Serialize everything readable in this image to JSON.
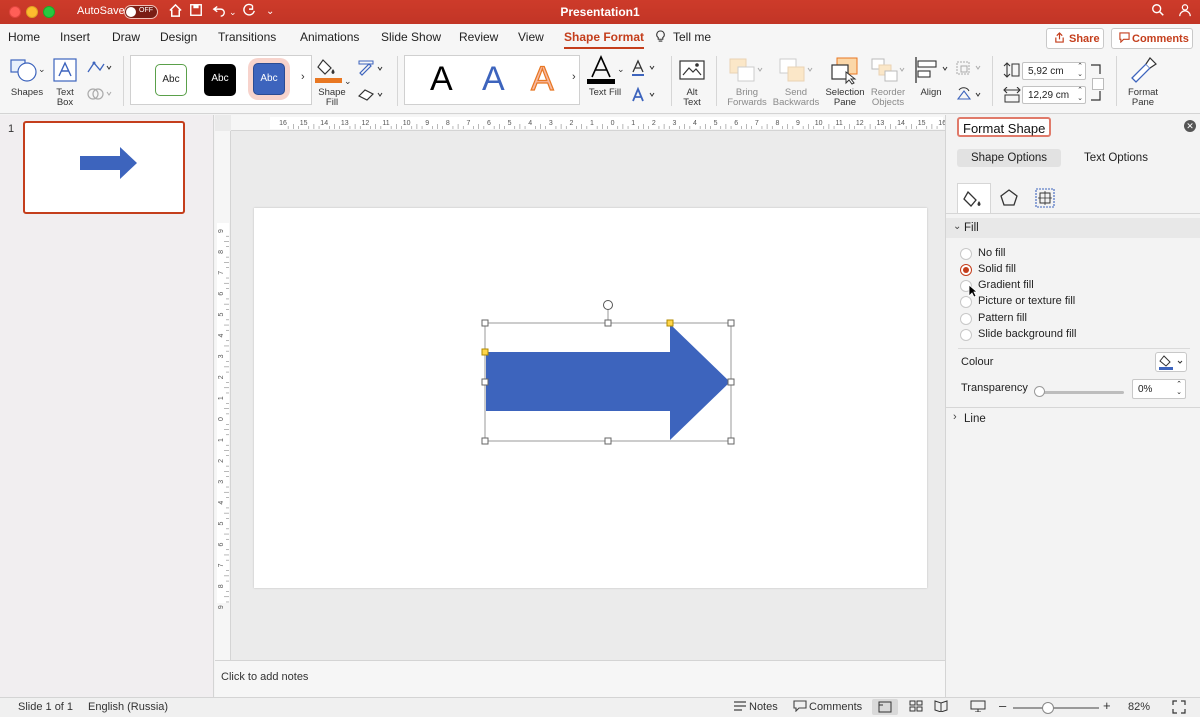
{
  "window": {
    "title": "Presentation1",
    "autosave_label": "AutoSave",
    "autosave_state": "OFF"
  },
  "tabs": [
    {
      "label": "Home"
    },
    {
      "label": "Insert"
    },
    {
      "label": "Draw"
    },
    {
      "label": "Design"
    },
    {
      "label": "Transitions"
    },
    {
      "label": "Animations"
    },
    {
      "label": "Slide Show"
    },
    {
      "label": "Review"
    },
    {
      "label": "View"
    },
    {
      "label": "Shape Format",
      "active": true
    },
    {
      "label": "Tell me"
    }
  ],
  "actions": {
    "share": "Share",
    "comments": "Comments"
  },
  "ribbon": {
    "shapes": "Shapes",
    "text_box_1": "Text",
    "text_box_2": "Box",
    "style_1": "Abc",
    "style_2": "Abc",
    "style_3": "Abc",
    "shape_fill_1": "Shape",
    "shape_fill_2": "Fill",
    "wordart": "A",
    "text_fill": "Text Fill",
    "alt_text_1": "Alt",
    "alt_text_2": "Text",
    "bring_forwards_1": "Bring",
    "bring_forwards_2": "Forwards",
    "send_backwards_1": "Send",
    "send_backwards_2": "Backwards",
    "selection_pane_1": "Selection",
    "selection_pane_2": "Pane",
    "reorder_objects_1": "Reorder",
    "reorder_objects_2": "Objects",
    "align": "Align",
    "height_value": "5,92 cm",
    "width_value": "12,29 cm",
    "format_pane_1": "Format",
    "format_pane_2": "Pane"
  },
  "thumbnails": {
    "slide_number": "1"
  },
  "ruler": {
    "h_ticks": [
      "16",
      "15",
      "14",
      "13",
      "12",
      "11",
      "10",
      "9",
      "8",
      "7",
      "6",
      "5",
      "4",
      "3",
      "2",
      "1",
      "0",
      "1",
      "2",
      "3",
      "4",
      "5",
      "6",
      "7",
      "8",
      "9",
      "10",
      "11",
      "12",
      "13",
      "14",
      "15",
      "16"
    ],
    "v_ticks": [
      "9",
      "8",
      "7",
      "6",
      "5",
      "4",
      "3",
      "2",
      "1",
      "0",
      "1",
      "2",
      "3",
      "4",
      "5",
      "6",
      "7",
      "8",
      "9"
    ]
  },
  "notes": {
    "placeholder": "Click to add notes"
  },
  "format_pane": {
    "title": "Format Shape",
    "tab_shape_options": "Shape Options",
    "tab_text_options": "Text Options",
    "fill_section": "Fill",
    "fill_options": [
      {
        "label": "No fill",
        "selected": false
      },
      {
        "label": "Solid fill",
        "selected": true
      },
      {
        "label": "Gradient fill",
        "selected": false
      },
      {
        "label": "Picture or texture fill",
        "selected": false
      },
      {
        "label": "Pattern fill",
        "selected": false
      },
      {
        "label": "Slide background fill",
        "selected": false
      }
    ],
    "colour_label": "Colour",
    "transparency_label": "Transparency",
    "transparency_value": "0%",
    "line_section": "Line"
  },
  "status_bar": {
    "slide_info": "Slide 1 of 1",
    "language": "English (Russia)",
    "notes": "Notes",
    "comments": "Comments",
    "zoom": "82%",
    "zoom_level": 0.82
  },
  "colors": {
    "accent": "#c43e1c",
    "shape_fill": "#3d64bd",
    "titlebar": "#c23526"
  }
}
